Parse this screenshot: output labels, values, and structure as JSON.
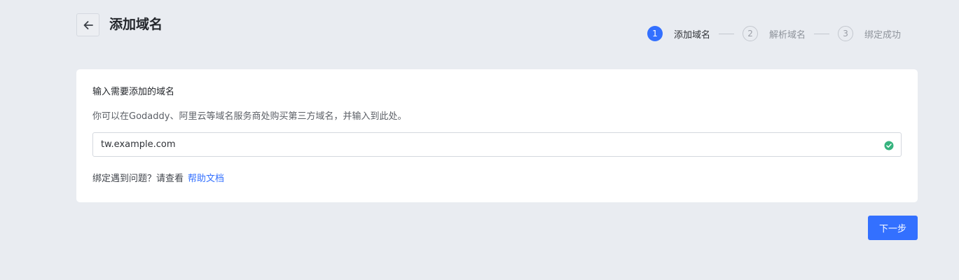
{
  "header": {
    "title": "添加域名",
    "back_icon": "arrow-left-icon"
  },
  "steps": [
    {
      "number": "1",
      "label": "添加域名",
      "state": "active"
    },
    {
      "number": "2",
      "label": "解析域名",
      "state": "inactive"
    },
    {
      "number": "3",
      "label": "绑定成功",
      "state": "inactive"
    }
  ],
  "card": {
    "title": "输入需要添加的域名",
    "description": "你可以在Godaddy、阿里云等域名服务商处购买第三方域名，并输入到此处。",
    "domain_input": {
      "value": "tw.example.com",
      "status_icon": "check-circle-icon",
      "status_color": "#36b37e"
    },
    "help_text": "绑定遇到问题？请查看",
    "help_link": "帮助文档"
  },
  "footer": {
    "next_label": "下一步"
  },
  "colors": {
    "accent": "#3370ff",
    "background": "#e9ecf1",
    "success": "#36b37e"
  }
}
